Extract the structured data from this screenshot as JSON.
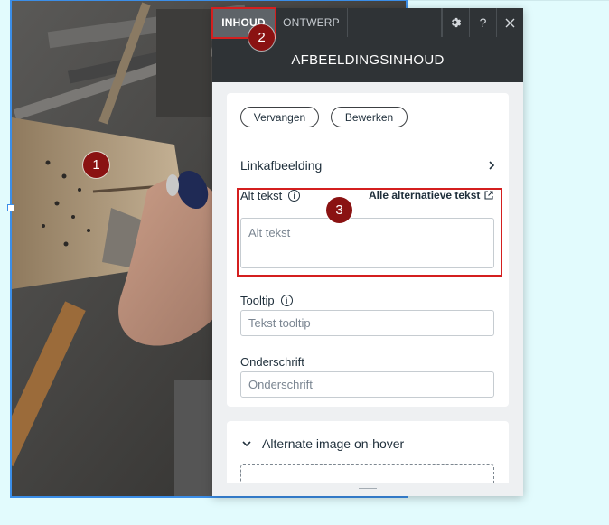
{
  "tabs": {
    "content": "INHOUD",
    "design": "ONTWERP"
  },
  "header": {
    "title": "AFBEELDINGSINHOUD",
    "settings_icon": "gear-icon",
    "help_label": "?",
    "close_icon": "close-icon"
  },
  "actions": {
    "replace": "Vervangen",
    "edit": "Bewerken"
  },
  "link_row": {
    "label": "Linkafbeelding",
    "icon": "chevron-right-icon"
  },
  "alt_text": {
    "label": "Alt tekst",
    "all_link": "Alle alternatieve tekst",
    "placeholder": "Alt tekst"
  },
  "tooltip": {
    "label": "Tooltip",
    "placeholder": "Tekst tooltip"
  },
  "caption": {
    "label": "Onderschrift",
    "placeholder": "Onderschrift"
  },
  "hover_section": {
    "label": "Alternate image on-hover",
    "icon": "chevron-down-icon"
  },
  "annotations": {
    "marker1": "1",
    "marker2": "2",
    "marker3": "3",
    "color": "#d41f1f"
  }
}
